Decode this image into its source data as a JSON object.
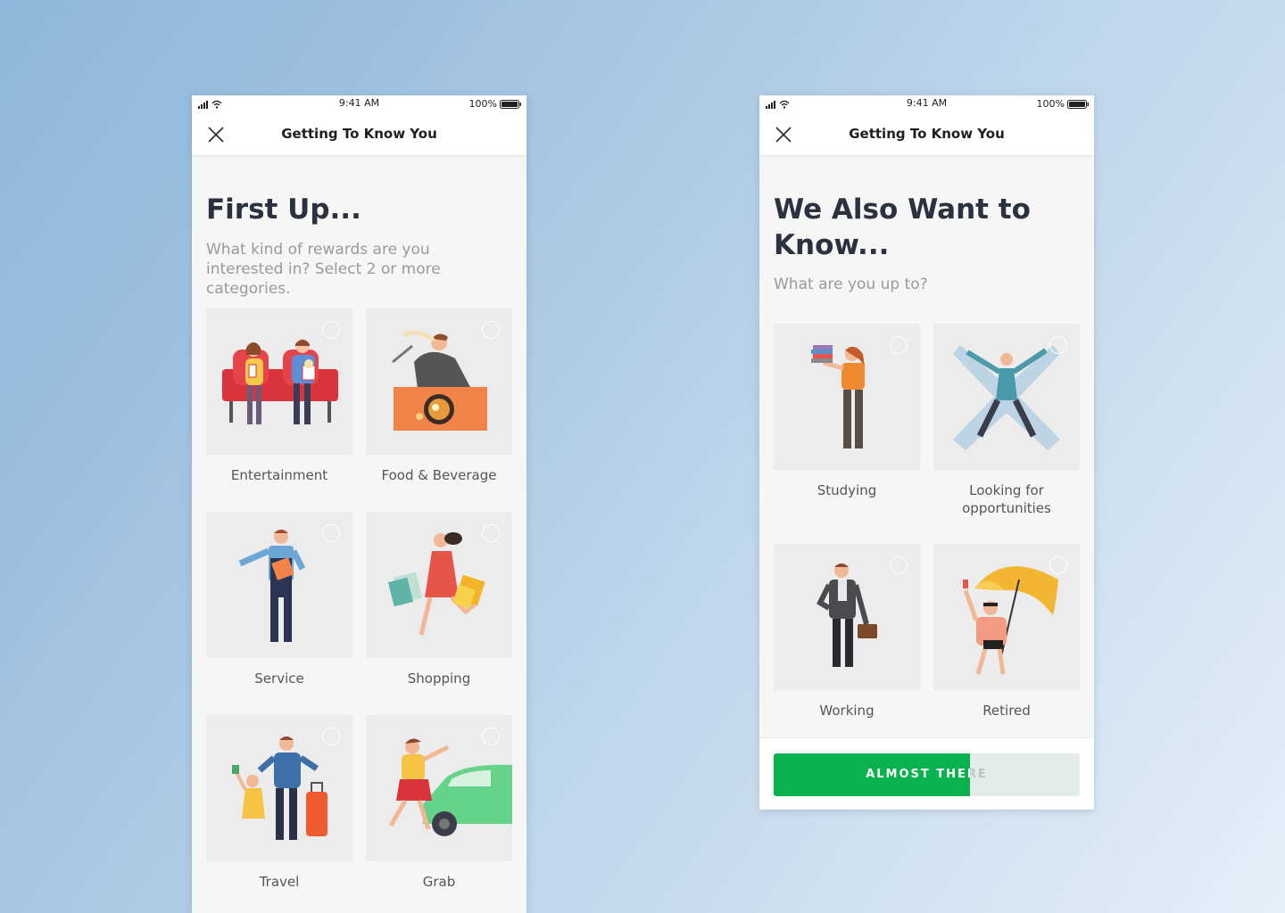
{
  "status_bar": {
    "time": "9:41 AM",
    "battery": "100%"
  },
  "screen1": {
    "nav_title": "Getting To Know You",
    "heading": "First Up...",
    "subtext": "What kind of rewards are you interested in? Select 2 or more categories.",
    "categories": [
      {
        "label": "Entertainment",
        "icon": "cinema-couple-illustration"
      },
      {
        "label": "Food & Beverage",
        "icon": "dining-man-illustration"
      },
      {
        "label": "Service",
        "icon": "mechanic-illustration"
      },
      {
        "label": "Shopping",
        "icon": "shopper-woman-illustration"
      },
      {
        "label": "Travel",
        "icon": "travelers-illustration"
      },
      {
        "label": "Grab",
        "icon": "hailing-car-illustration"
      }
    ]
  },
  "screen2": {
    "nav_title": "Getting To Know You",
    "heading": "We Also Want to Know...",
    "subtext": "What are you up to?",
    "options": [
      {
        "label": "Studying",
        "icon": "student-books-illustration"
      },
      {
        "label": "Looking for opportunities",
        "icon": "snow-angel-illustration"
      },
      {
        "label": "Working",
        "icon": "businessman-illustration"
      },
      {
        "label": "Retired",
        "icon": "umbrella-relax-illustration"
      }
    ],
    "progress": {
      "label": "ALMOST THERE",
      "fraction": 0.64
    }
  },
  "colors": {
    "accent_green": "#09b14f",
    "heading": "#2c3140",
    "card_bg": "#ececec"
  }
}
